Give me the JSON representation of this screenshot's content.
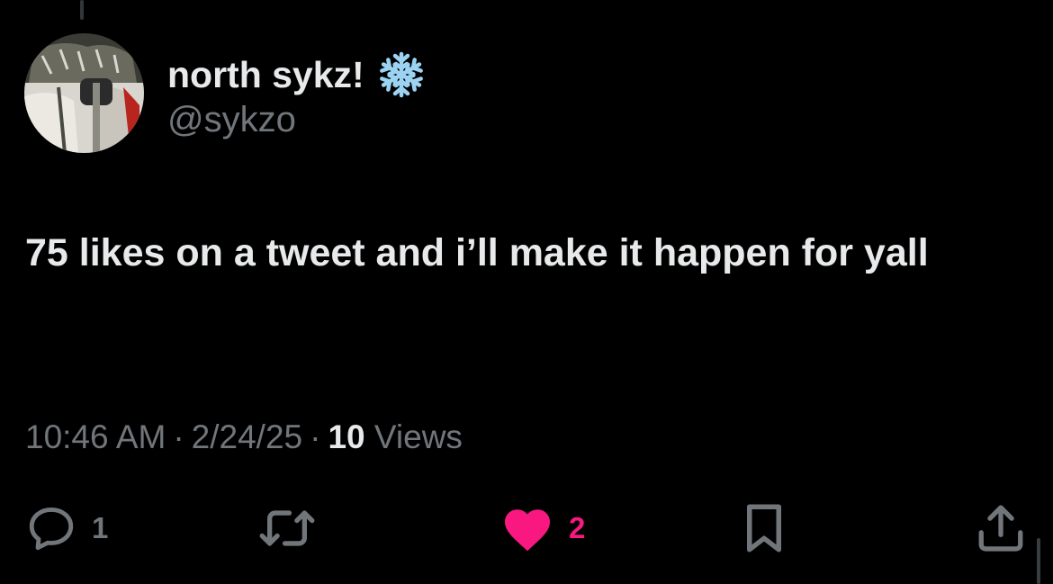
{
  "tweet": {
    "display_name": "north sykz!",
    "badge_emoji": "snowflake-icon",
    "handle": "@sykzo",
    "text": "75 likes on a tweet and i’ll make it happen for yall",
    "time": "10:46 AM",
    "date": "2/24/25",
    "separator": "·",
    "views_count": "10",
    "views_label": "Views"
  },
  "actions": {
    "replies": "1",
    "retweets": "",
    "likes": "2",
    "bookmarks": "",
    "share": ""
  },
  "colors": {
    "background": "#000000",
    "primary_text": "#e7e9ea",
    "secondary_text": "#71767b",
    "like_pink": "#f91880",
    "snowflake_blue": "#9cd3f2"
  }
}
